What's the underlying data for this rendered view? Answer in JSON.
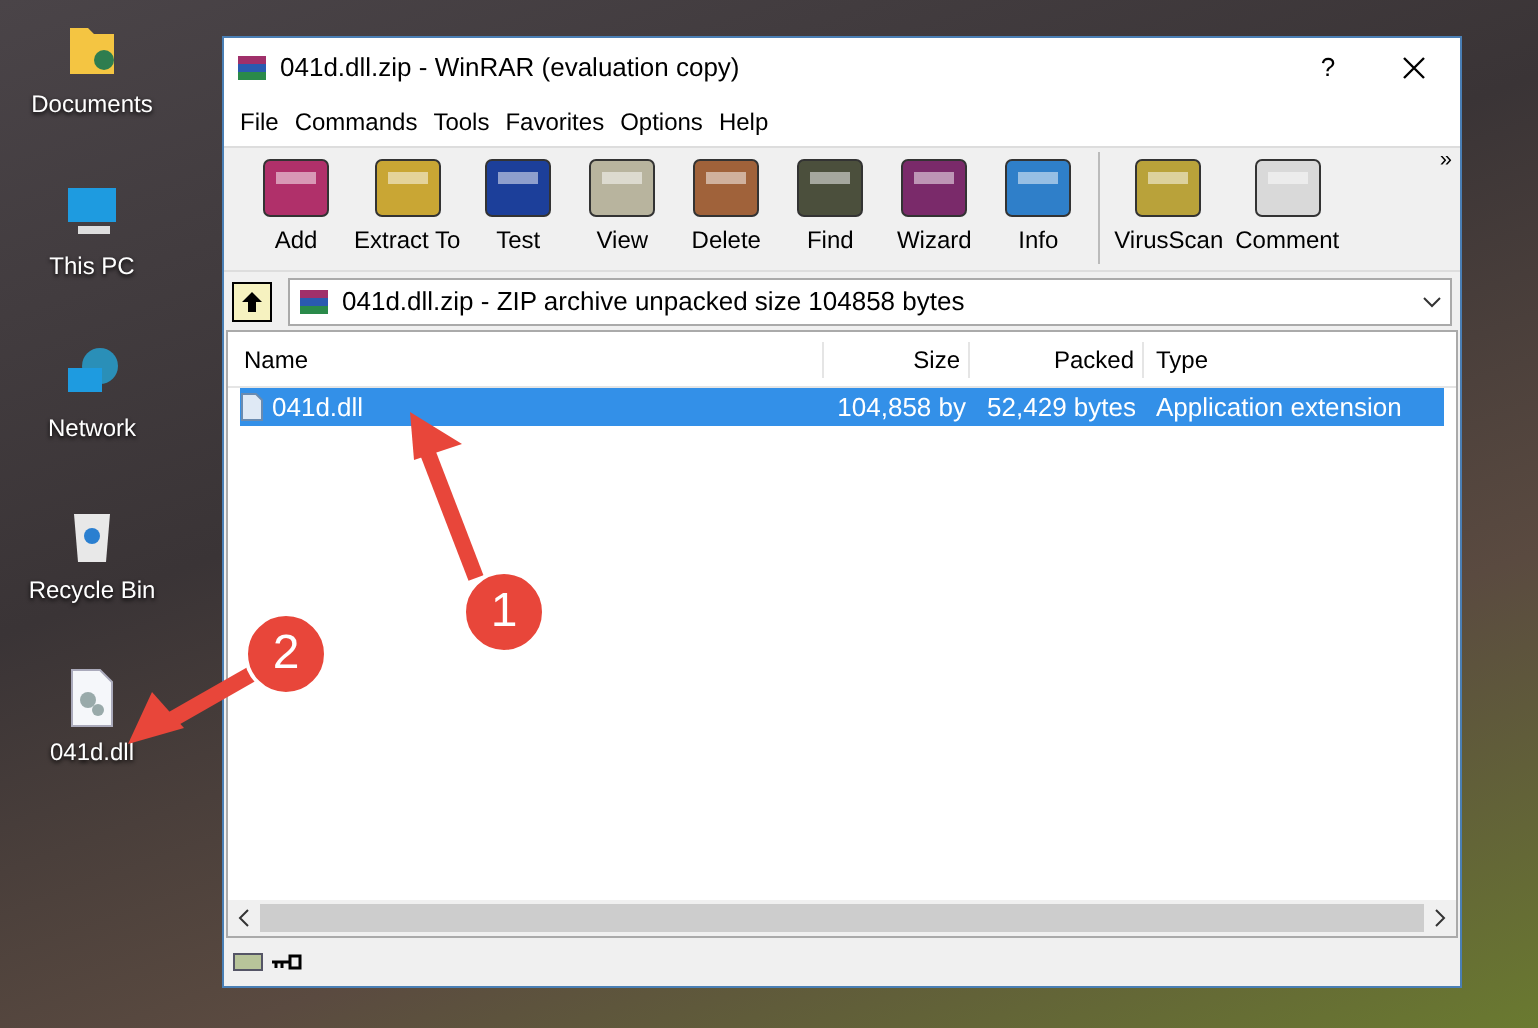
{
  "desktop_icons": [
    {
      "label": "Documents",
      "kind": "folder"
    },
    {
      "label": "This PC",
      "kind": "pc"
    },
    {
      "label": "Network",
      "kind": "network"
    },
    {
      "label": "Recycle Bin",
      "kind": "bin"
    },
    {
      "label": "041d.dll",
      "kind": "file"
    }
  ],
  "window": {
    "title": "041d.dll.zip - WinRAR (evaluation copy)",
    "help": "?"
  },
  "menu": [
    "File",
    "Commands",
    "Tools",
    "Favorites",
    "Options",
    "Help"
  ],
  "toolbar": [
    {
      "label": "Add",
      "kind": "add"
    },
    {
      "label": "Extract To",
      "kind": "extract"
    },
    {
      "label": "Test",
      "kind": "test"
    },
    {
      "label": "View",
      "kind": "view"
    },
    {
      "label": "Delete",
      "kind": "delete"
    },
    {
      "label": "Find",
      "kind": "find"
    },
    {
      "label": "Wizard",
      "kind": "wizard"
    },
    {
      "label": "Info",
      "kind": "info"
    },
    {
      "label": "VirusScan",
      "kind": "virusscan"
    },
    {
      "label": "Comment",
      "kind": "comment"
    }
  ],
  "toolbar_more": "»",
  "address": "041d.dll.zip - ZIP archive unpacked size 104858 bytes",
  "columns": [
    "Name",
    "Size",
    "Packed",
    "Type"
  ],
  "rows": [
    {
      "name": "041d.dll",
      "size": "104,858 by",
      "packed": "52,429 bytes",
      "type": "Application extension",
      "selected": true
    }
  ],
  "annotations": [
    "1",
    "2"
  ]
}
